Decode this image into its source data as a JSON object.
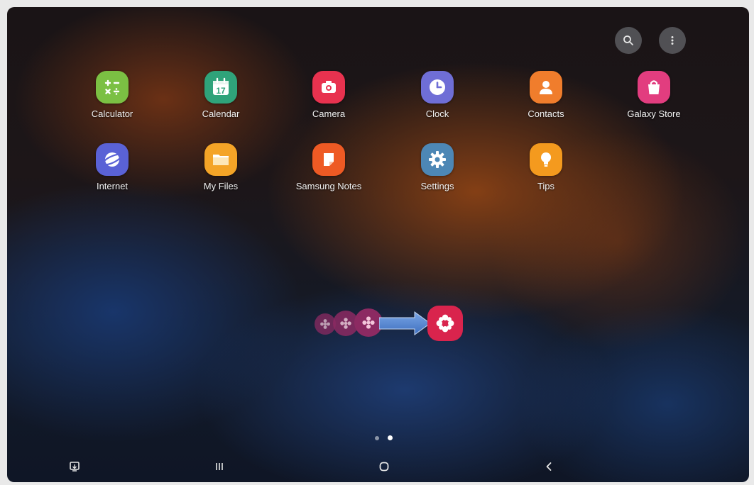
{
  "apps": [
    {
      "label": "Calculator",
      "color": "#7bc043",
      "icon": "calculator-icon"
    },
    {
      "label": "Calendar",
      "color": "#2fa37a",
      "icon": "calendar-icon"
    },
    {
      "label": "Camera",
      "color": "#e8324f",
      "icon": "camera-icon"
    },
    {
      "label": "Clock",
      "color": "#6f6ed6",
      "icon": "clock-icon"
    },
    {
      "label": "Contacts",
      "color": "#f07d2c",
      "icon": "contacts-icon"
    },
    {
      "label": "Galaxy Store",
      "color": "#e23d7f",
      "icon": "galaxy-store-icon"
    },
    {
      "label": "Internet",
      "color": "#5a62d6",
      "icon": "internet-icon"
    },
    {
      "label": "My Files",
      "color": "#f4a427",
      "icon": "folder-icon"
    },
    {
      "label": "Samsung Notes",
      "color": "#ee5a24",
      "icon": "notes-icon"
    },
    {
      "label": "Settings",
      "color": "#4d87b5",
      "icon": "gear-icon"
    },
    {
      "label": "Tips",
      "color": "#f49a1e",
      "icon": "lightbulb-icon"
    }
  ],
  "calendar_day": "17",
  "top_actions": {
    "search_icon": "search-icon",
    "more_icon": "more-options-icon"
  },
  "page_indicator": {
    "count": 2,
    "active": 1
  },
  "nav_bar": [
    "screenshot-icon",
    "recent-apps-icon",
    "home-icon",
    "back-icon"
  ],
  "overlay": {
    "small_icon_color": "#8c2a62",
    "large_icon_color": "#d9244d",
    "arrow_color": "#5b8ad0"
  }
}
